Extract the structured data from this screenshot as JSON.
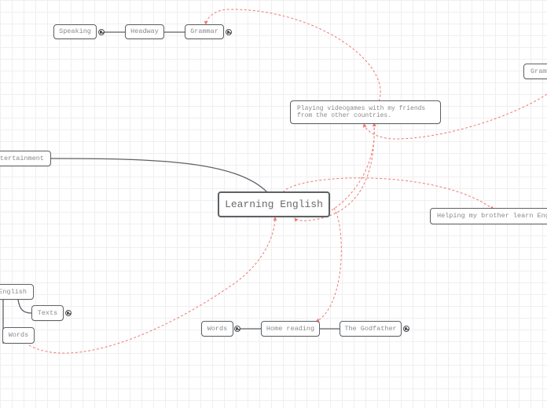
{
  "map": {
    "title": "Learning English",
    "colors": {
      "node_border": "#5d6166",
      "node_text": "#8a8a8a",
      "link_solid": "#5d6166",
      "relationship_dashed": "#f07a74",
      "grid": "#efefef"
    },
    "nodes": {
      "root": "Learning English",
      "speaking": "Speaking",
      "headway": "Headway",
      "grammar_top": "Grammar",
      "grammar_right": "Grammar",
      "videogames": "Playing videogames with my friends\nfrom the other countries.",
      "entertainment": "Entertainment",
      "helping": "Helping my brother  learn English",
      "english_left": "English",
      "texts": "Texts",
      "words_left": "Words",
      "words_bottom": "Words",
      "home_reading": "Home reading",
      "godfather": "The Godfather"
    },
    "link_icons": [
      "globe-icon"
    ]
  }
}
